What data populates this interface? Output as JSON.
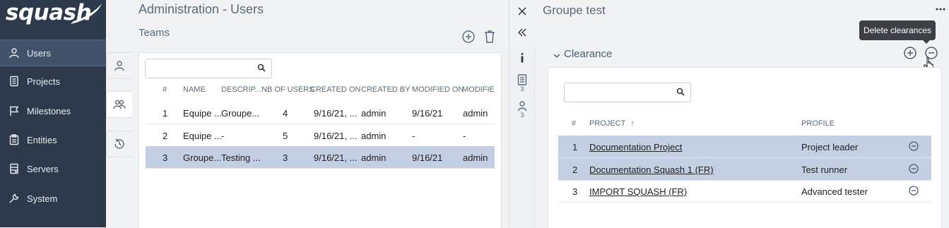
{
  "brand": {
    "logo_text": "squash"
  },
  "sidebar": {
    "items": [
      {
        "label": "Users",
        "icon": "user-icon",
        "active": true
      },
      {
        "label": "Projects",
        "icon": "document-icon",
        "active": false
      },
      {
        "label": "Milestones",
        "icon": "flag-icon",
        "active": false
      },
      {
        "label": "Entities",
        "icon": "clipboard-icon",
        "active": false
      },
      {
        "label": "Servers",
        "icon": "server-icon",
        "active": false
      },
      {
        "label": "System",
        "icon": "wrench-icon",
        "active": false
      }
    ]
  },
  "main": {
    "page_title": "Administration - Users",
    "section_title": "Teams",
    "toolbar": {
      "add_icon": "add-circle-icon",
      "delete_icon": "trash-icon"
    },
    "side_tabs": [
      {
        "icon": "user-icon",
        "active": false
      },
      {
        "icon": "team-icon",
        "active": true
      },
      {
        "icon": "history-icon",
        "active": false
      }
    ],
    "search": {
      "value": "",
      "placeholder": ""
    },
    "table": {
      "columns": [
        "#",
        "NAME",
        "DESCRIP...",
        "NB OF USERS",
        "CREATED ON",
        "CREATED BY",
        "MODIFIED ON",
        "MODIFIE"
      ],
      "rows": [
        {
          "num": "1",
          "name": "Equipe ...",
          "description": "Groupe...",
          "nb_users": "4",
          "created_on": "9/16/21, ...",
          "created_by": "admin",
          "modified_on": "9/16/21",
          "modified_by": "admin",
          "selected": false
        },
        {
          "num": "2",
          "name": "Equipe ...",
          "description": "-",
          "nb_users": "5",
          "created_on": "9/16/21, ...",
          "created_by": "admin",
          "modified_on": "-",
          "modified_by": "-",
          "selected": false
        },
        {
          "num": "3",
          "name": "Groupe...",
          "description": "Testing ...",
          "nb_users": "3",
          "created_on": "9/16/21, ...",
          "created_by": "admin",
          "modified_on": "9/16/21",
          "modified_by": "admin",
          "selected": true
        }
      ]
    }
  },
  "detail": {
    "title": "Groupe test",
    "more_icon": "more-horizontal-icon",
    "close_icon": "close-icon",
    "collapse_icon": "double-chevron-left-icon",
    "strip": [
      {
        "icon": "info-icon",
        "count": ""
      },
      {
        "icon": "document-icon",
        "count": "3"
      },
      {
        "icon": "user-icon",
        "count": "3"
      }
    ],
    "section": {
      "title": "Clearance",
      "tooltip": "Delete clearances",
      "search": {
        "value": "",
        "placeholder": ""
      },
      "columns": [
        "#",
        "PROJECT",
        "PROFILE"
      ],
      "sort_indicator": "↑",
      "rows": [
        {
          "num": "1",
          "project": "Documentation Project",
          "profile": "Project leader",
          "selected": true
        },
        {
          "num": "2",
          "project": "Documentation Squash 1 (FR)",
          "profile": "Test runner",
          "selected": true
        },
        {
          "num": "3",
          "project": "IMPORT SQUASH (FR)",
          "profile": "Advanced tester",
          "selected": false
        }
      ]
    }
  }
}
